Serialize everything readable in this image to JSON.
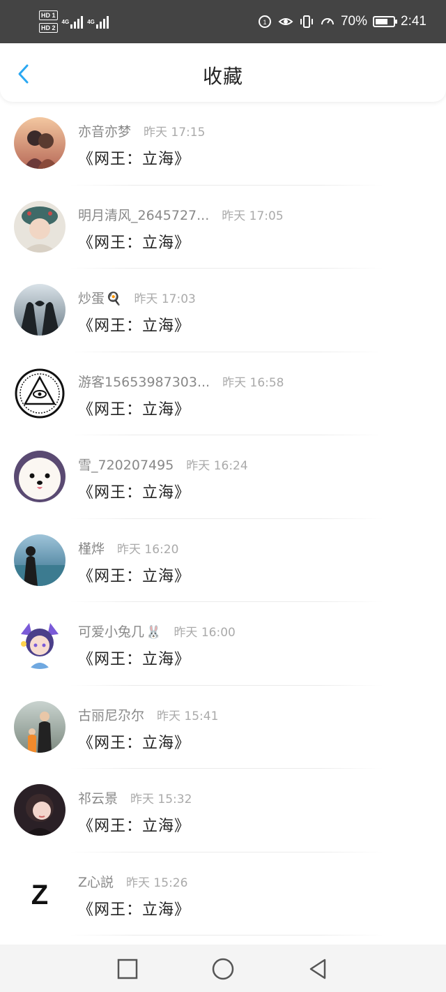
{
  "status_bar": {
    "hd1": "HD 1",
    "hd2": "HD 2",
    "net1": "4G",
    "net2": "4G",
    "battery": "70%",
    "battery_level": 0.7,
    "time": "2:41"
  },
  "header": {
    "title": "收藏",
    "back_icon": "chevron-left-icon",
    "accent_color": "#2aa8f2"
  },
  "favorites": [
    {
      "name": "亦音亦梦",
      "time": "昨天 17:15",
      "content": "《网王：立海》",
      "avatar": "anime-couple"
    },
    {
      "name": "明月清风_2645727...",
      "time": "昨天 17:05",
      "content": "《网王：立海》",
      "avatar": "opera-headdress"
    },
    {
      "name": "炒蛋",
      "name_emoji": "🍳",
      "time": "昨天 17:03",
      "content": "《网王：立海》",
      "avatar": "heart-hands"
    },
    {
      "name": "游客15653987303...",
      "time": "昨天 16:58",
      "content": "《网王：立海》",
      "avatar": "eye-pyramid"
    },
    {
      "name": "雪_720207495",
      "time": "昨天 16:24",
      "content": "《网王：立海》",
      "avatar": "white-dog"
    },
    {
      "name": "槿烨",
      "time": "昨天 16:20",
      "content": "《网王：立海》",
      "avatar": "girl-seaside"
    },
    {
      "name": "可爱小兔几",
      "name_emoji": "🐰",
      "time": "昨天 16:00",
      "content": "《网王：立海》",
      "avatar": "anime-girl"
    },
    {
      "name": "古丽尼尕尔",
      "time": "昨天 15:41",
      "content": "《网王：立海》",
      "avatar": "family-photo"
    },
    {
      "name": "祁云景",
      "time": "昨天 15:32",
      "content": "《网王：立海》",
      "avatar": "woman-portrait"
    },
    {
      "name": "Z心説",
      "time": "昨天 15:26",
      "content": "《网王：立海》",
      "avatar": "letter-z",
      "avatar_text": "Z"
    }
  ],
  "nav": {
    "recent": "square-icon",
    "home": "circle-icon",
    "back": "triangle-back-icon"
  }
}
